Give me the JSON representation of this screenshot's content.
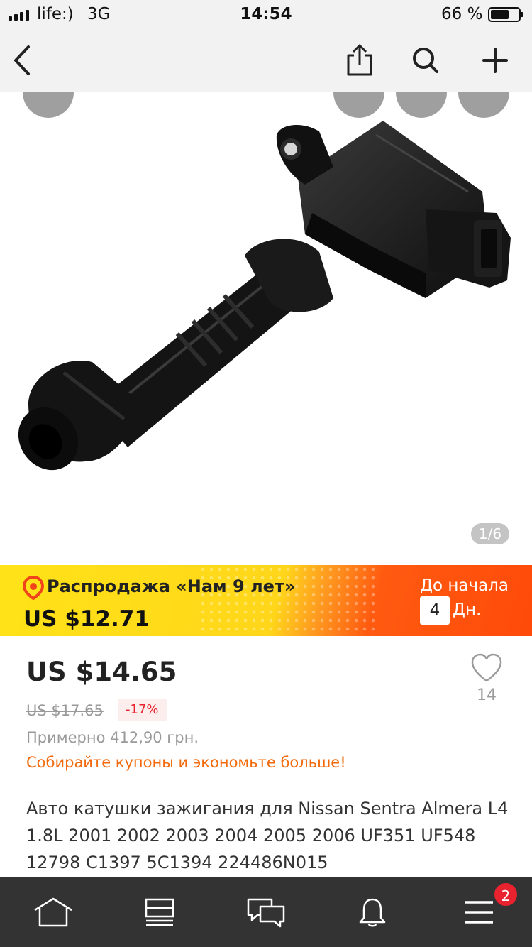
{
  "status_bar": {
    "carrier": "life:)",
    "network": "3G",
    "time": "14:54",
    "battery_percent": "66 %",
    "battery_level": 0.66
  },
  "nav_bar": {
    "icons": [
      "back-icon",
      "share-icon",
      "search-icon",
      "plus-icon"
    ]
  },
  "gallery": {
    "page_indicator": "1/6",
    "current_image": 1,
    "total_images": 6
  },
  "sale_banner": {
    "title": "Распродажа «Нам 9 лет»",
    "price": "US $12.71",
    "countdown_label": "До начала",
    "countdown_value": "4",
    "countdown_unit": "Дн."
  },
  "product": {
    "price": "US $14.65",
    "old_price": "US $17.65",
    "discount": "-17%",
    "approx_price": "Примерно 412,90 грн.",
    "coupons_link": "Собирайте купоны и экономьте больше!",
    "wishlist_count": "14",
    "title": "Авто катушки зажигания для Nissan Sentra Almera L4 1.8L 2001 2002 2003 2004 2005 2006 UF351 UF548 12798 C1397 5C1394 224486N015"
  },
  "tab_bar": {
    "icons": [
      "home-icon",
      "categories-icon",
      "messages-icon",
      "notifications-icon",
      "menu-icon"
    ],
    "menu_badge": "2"
  },
  "colors": {
    "accent": "#f26a0c",
    "discount_red": "#e8222e",
    "sale_yellow": "#ffd61a",
    "sale_orange": "#ff4a0a",
    "tab_bar_bg": "#333333"
  }
}
